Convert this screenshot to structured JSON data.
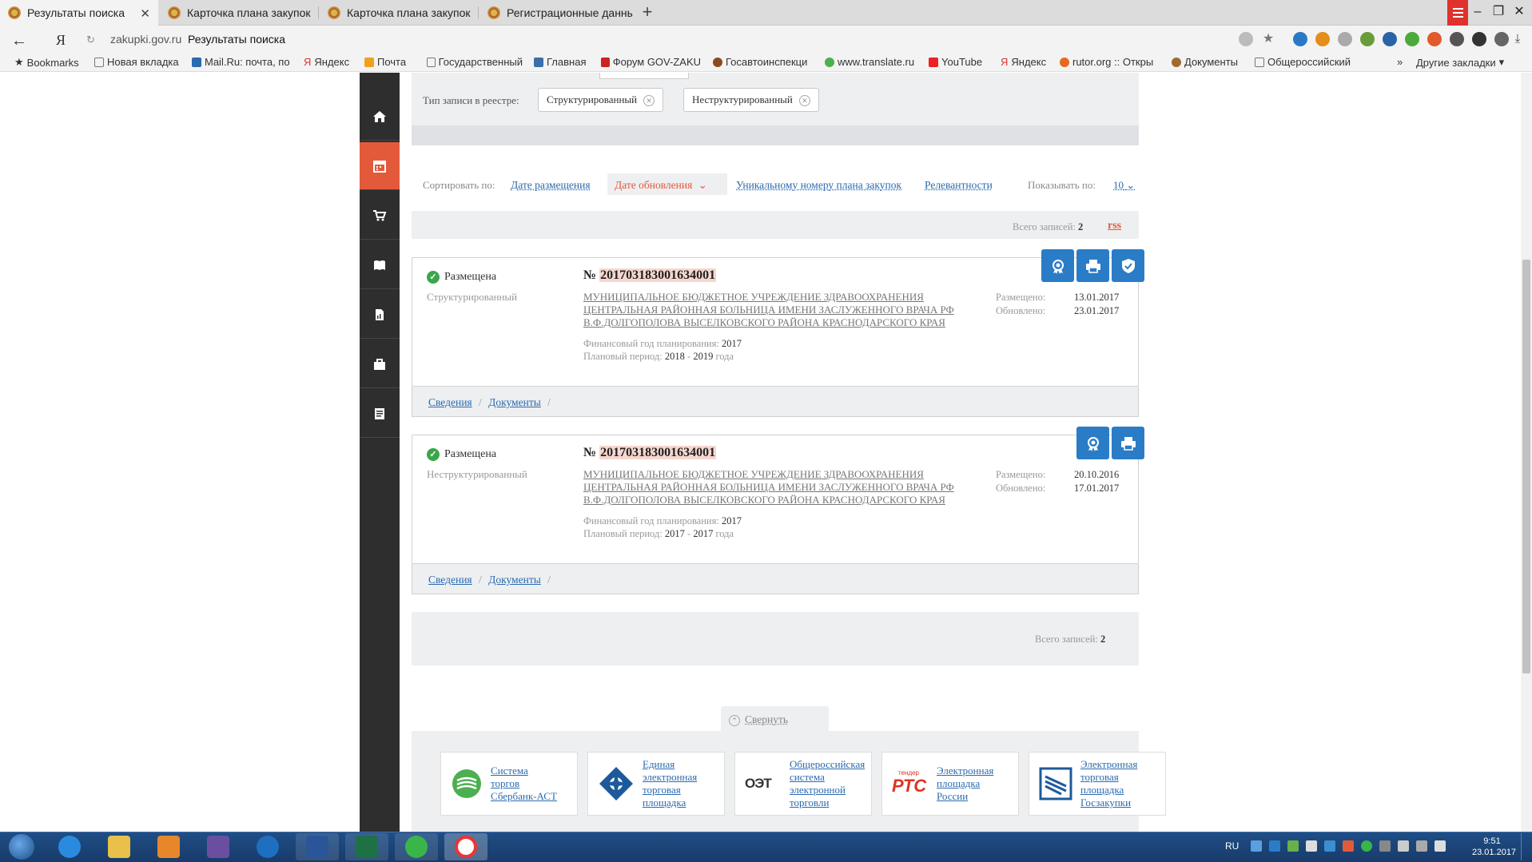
{
  "browser": {
    "tabs": [
      {
        "title": "Результаты поиска",
        "active": true
      },
      {
        "title": "Карточка плана закупок",
        "active": false
      },
      {
        "title": "Карточка плана закупок",
        "active": false
      },
      {
        "title": "Регистрационные данные с",
        "active": false
      }
    ],
    "new_tab": "+",
    "address": {
      "url": "zakupki.gov.ru",
      "title": "Результаты поиска",
      "ya": "Я"
    },
    "bookmarks": [
      "Bookmarks",
      "Новая вкладка",
      "Mail.Ru: почта, по",
      "Яндекс",
      "Почта",
      "Государственный",
      "Главная",
      "Форум GOV-ZAKU",
      "Госавтоинспекци",
      "www.translate.ru",
      "YouTube",
      "Яндекс",
      "rutor.org :: Откры",
      "Документы",
      "Общероссийский"
    ],
    "other_bookmarks": "Другие закладки",
    "more_bookmarks": "»"
  },
  "filter": {
    "label": "Тип записи в реестре:",
    "chips": [
      "Структурированный",
      "Неструктурированный"
    ]
  },
  "sort": {
    "label": "Сортировать по:",
    "options": [
      "Дате размещения",
      "Дате обновления",
      "Уникальному номеру плана закупок",
      "Релевантности"
    ],
    "active": "Дате обновления",
    "show_label": "Показывать по:",
    "show_value": "10"
  },
  "total_top": {
    "label": "Всего записей:",
    "value": "2",
    "rss": "rss"
  },
  "results": [
    {
      "status": "Размещена",
      "type": "Структурированный",
      "number_prefix": "№",
      "number": "201703183001634001",
      "org_lines": [
        "МУНИЦИПАЛЬНОЕ БЮДЖЕТНОЕ УЧРЕЖДЕНИЕ ЗДРАВООХРАНЕНИЯ",
        "ЦЕНТРАЛЬНАЯ РАЙОННАЯ БОЛЬНИЦА ИМЕНИ ЗАСЛУЖЕННОГО ВРАЧА РФ",
        "В.Ф.ДОЛГОПОЛОВА ВЫСЕЛКОВСКОГО РАЙОНА КРАСНОДАРСКОГО КРАЯ"
      ],
      "fin_year_label": "Финансовый год планирования:",
      "fin_year": "2017",
      "period_label": "Плановый период:",
      "period_from": "2018",
      "period_sep": "-",
      "period_to": "2019",
      "period_suffix": "года",
      "placed_label": "Размещено:",
      "placed": "13.01.2017",
      "updated_label": "Обновлено:",
      "updated": "23.01.2017",
      "links": [
        "Сведения",
        "Документы"
      ],
      "link_sep": "/"
    },
    {
      "status": "Размещена",
      "type": "Неструктурированный",
      "number_prefix": "№",
      "number": "201703183001634001",
      "org_lines": [
        "МУНИЦИПАЛЬНОЕ БЮДЖЕТНОЕ УЧРЕЖДЕНИЕ ЗДРАВООХРАНЕНИЯ",
        "ЦЕНТРАЛЬНАЯ РАЙОННАЯ БОЛЬНИЦА ИМЕНИ ЗАСЛУЖЕННОГО ВРАЧА РФ",
        "В.Ф.ДОЛГОПОЛОВА ВЫСЕЛКОВСКОГО РАЙОНА КРАСНОДАРСКОГО КРАЯ"
      ],
      "fin_year_label": "Финансовый год планирования:",
      "fin_year": "2017",
      "period_label": "Плановый период:",
      "period_from": "2017",
      "period_sep": "-",
      "period_to": "2017",
      "period_suffix": "года",
      "placed_label": "Размещено:",
      "placed": "20.10.2016",
      "updated_label": "Обновлено:",
      "updated": "17.01.2017",
      "links": [
        "Сведения",
        "Документы"
      ],
      "link_sep": "/"
    }
  ],
  "total_bottom": {
    "label": "Всего записей:",
    "value": "2"
  },
  "collapse": "Свернуть",
  "partners": [
    {
      "label": [
        "Система",
        "торгов",
        "Сбербанк-АСТ"
      ]
    },
    {
      "label": [
        "Единая",
        "электронная",
        "торговая",
        "площадка"
      ]
    },
    {
      "label": [
        "Общероссийская",
        "система",
        "электронной",
        "торговли"
      ]
    },
    {
      "label": [
        "Электронная",
        "площадка",
        "России"
      ],
      "logo_text": "РТС",
      "logo_sub": "тендер"
    },
    {
      "label": [
        "Электронная",
        "торговая",
        "площадка",
        "Госзакупки"
      ]
    }
  ],
  "partner_logo_text": {
    "oset": "ОЭТ"
  },
  "tray": {
    "lang": "RU",
    "time": "9:51",
    "date": "23.01.2017"
  },
  "colors": {
    "accent": "#e35a3b",
    "link": "#2a6ab0",
    "button": "#2a7cc7",
    "sidebar": "#2e2e2e",
    "highlight": "#f6d7cf"
  }
}
